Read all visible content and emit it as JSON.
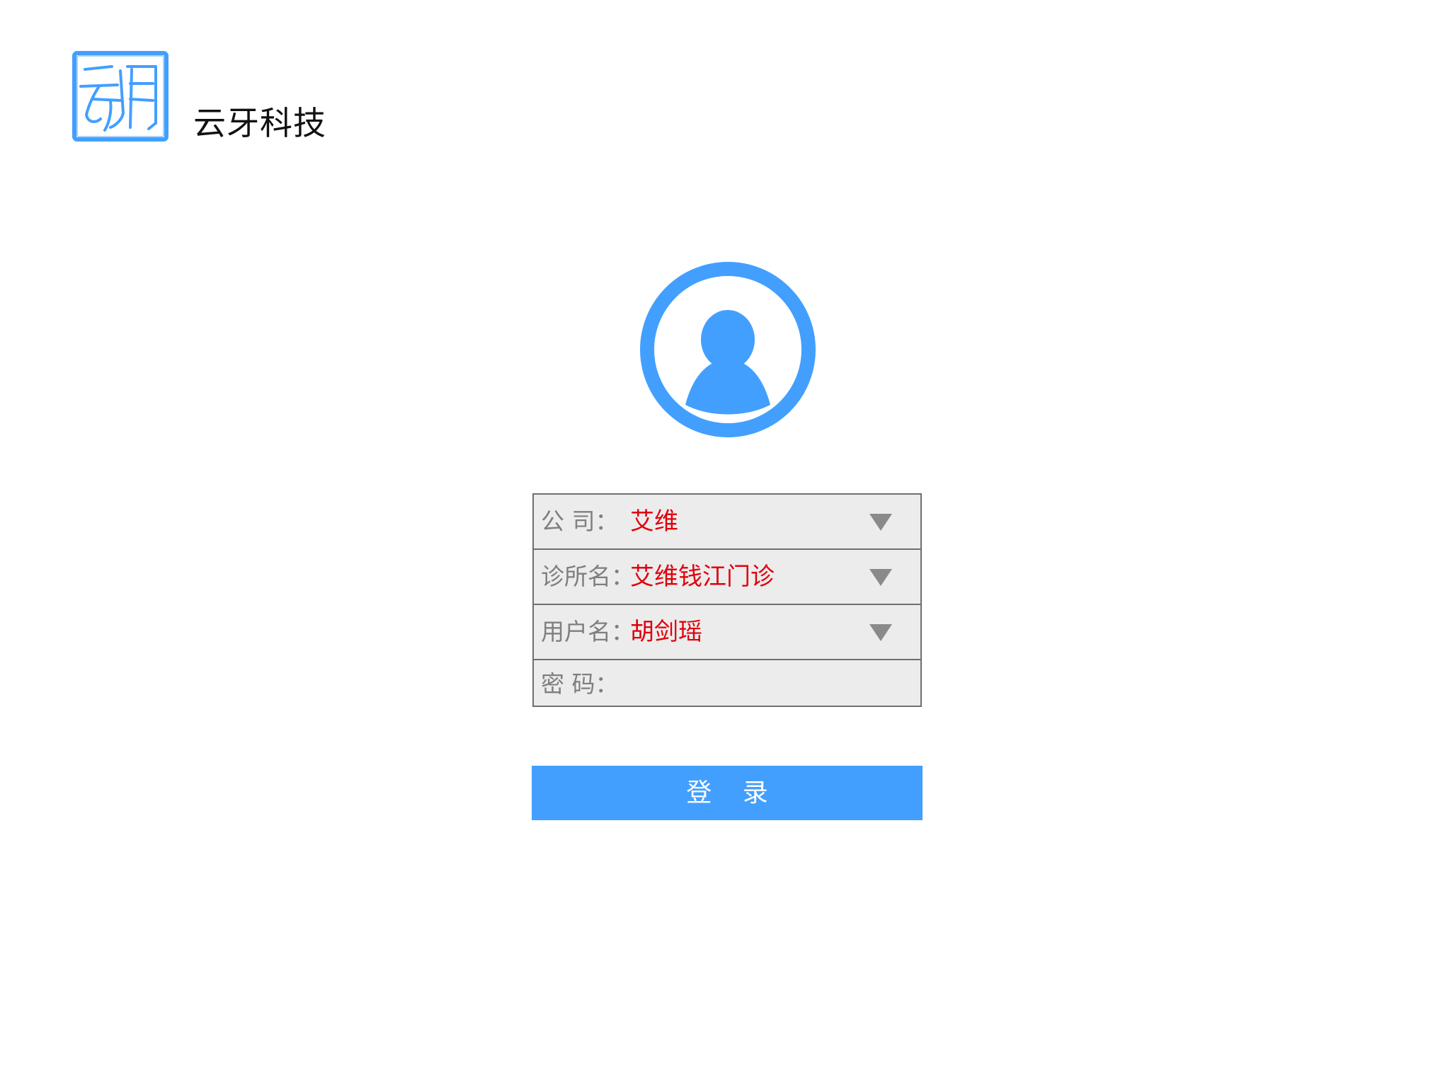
{
  "brand": {
    "name": "云牙科技",
    "logo_icon": "seal-logo",
    "accent_color": "#439ffe"
  },
  "avatar": {
    "icon": "user-avatar-icon"
  },
  "form": {
    "company": {
      "label": "公 司：",
      "value": "艾维",
      "icon": "chevron-down-icon"
    },
    "clinic": {
      "label": "诊所名：",
      "value": "艾维钱江门诊",
      "icon": "chevron-down-icon"
    },
    "username": {
      "label": "用户名：",
      "value": "胡剑瑶",
      "icon": "chevron-down-icon"
    },
    "password": {
      "label": "密 码：",
      "value": ""
    },
    "value_color": "#e0000b",
    "label_color": "#7f7f7f"
  },
  "login_button": {
    "label": "登 录"
  }
}
